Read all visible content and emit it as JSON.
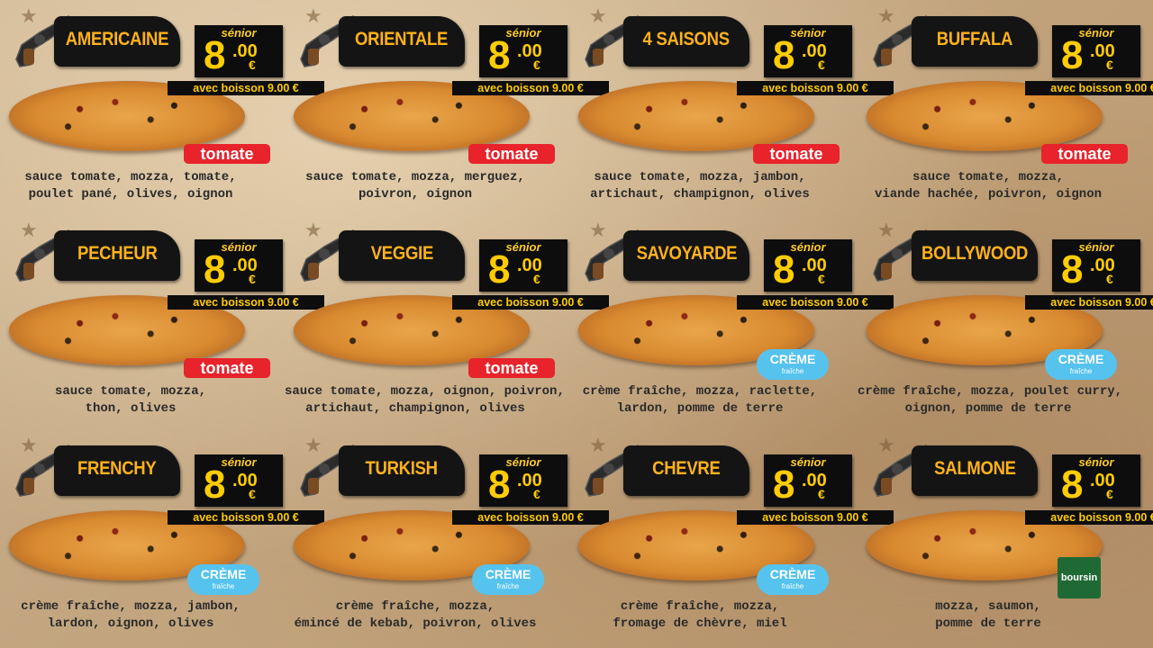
{
  "menu": {
    "price_label": "sénior",
    "price_main": "8",
    "price_cents": ".00",
    "price_currency": "€",
    "combo_text": "avec boisson 9.00 €",
    "sauces": {
      "tomate": "tomate",
      "creme_line1": "CRÈME",
      "creme_line2": "fraîche",
      "boursin": "boursin"
    },
    "pizzas": [
      {
        "name": "AMERICAINE",
        "sauce": "tomate",
        "line1": "sauce tomate, mozza, tomate,",
        "line2": "poulet pané, olives, oignon"
      },
      {
        "name": "ORIENTALE",
        "sauce": "tomate",
        "line1": "sauce tomate, mozza, merguez,",
        "line2": "poivron, oignon"
      },
      {
        "name": "4 SAISONS",
        "sauce": "tomate",
        "line1": "sauce tomate, mozza, jambon,",
        "line2": "artichaut, champignon, olives"
      },
      {
        "name": "BUFFALA",
        "sauce": "tomate",
        "line1": "sauce tomate, mozza,",
        "line2": "viande hachée, poivron, oignon"
      },
      {
        "name": "PECHEUR",
        "sauce": "tomate",
        "line1": "sauce tomate, mozza,",
        "line2": "thon, olives"
      },
      {
        "name": "VEGGIE",
        "sauce": "tomate",
        "line1": "sauce tomate, mozza, oignon, poivron,",
        "line2": "artichaut, champignon, olives"
      },
      {
        "name": "SAVOYARDE",
        "sauce": "creme",
        "line1": "crème fraîche, mozza, raclette,",
        "line2": "lardon, pomme de terre"
      },
      {
        "name": "BOLLYWOOD",
        "sauce": "creme",
        "line1": "crème fraîche, mozza, poulet curry,",
        "line2": "oignon, pomme de terre"
      },
      {
        "name": "FRENCHY",
        "sauce": "creme",
        "line1": "crème fraîche, mozza, jambon,",
        "line2": "lardon, oignon, olives"
      },
      {
        "name": "TURKISH",
        "sauce": "creme",
        "line1": "crème fraîche, mozza,",
        "line2": "émincé de kebab, poivron, olives"
      },
      {
        "name": "CHEVRE",
        "sauce": "creme",
        "line1": "crème fraîche, mozza,",
        "line2": "fromage de chèvre, miel"
      },
      {
        "name": "SALMONE",
        "sauce": "boursin",
        "line1": "mozza, saumon,",
        "line2": "pomme de terre"
      }
    ]
  }
}
